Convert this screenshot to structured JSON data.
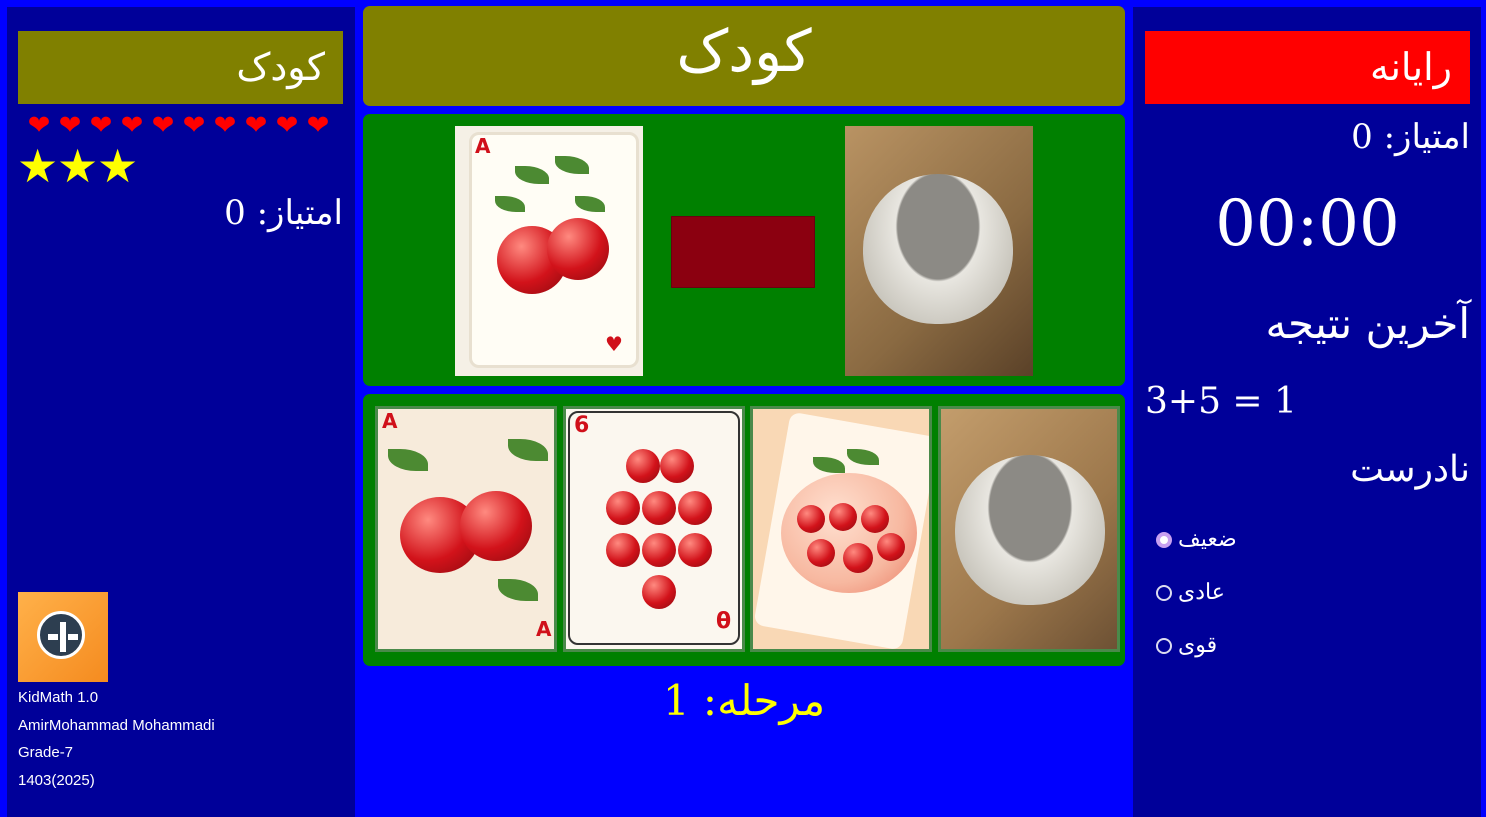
{
  "left_panel": {
    "player_name": "کودک",
    "hearts": [
      "❤",
      "❤",
      "❤",
      "❤",
      "❤",
      "❤",
      "❤",
      "❤",
      "❤",
      "❤"
    ],
    "stars": [
      "★",
      "★",
      "★"
    ],
    "score_text": "امتیاز: 0",
    "app_info": {
      "version": "KidMath 1.0",
      "author": "AmirMohammad Mohammadi",
      "grade": "Grade-7",
      "year": "1403(2025)"
    }
  },
  "center": {
    "title": "کودک",
    "question": {
      "left_card": "apple-card-image",
      "operator": "",
      "right_card": "empty-bowl-image"
    },
    "choices": [
      {
        "image": "two-apples-card"
      },
      {
        "image": "nine-apples-card"
      },
      {
        "image": "apple-card-with-crossed-apple"
      },
      {
        "image": "empty-bowl-image"
      }
    ],
    "level_text": "مرحله: 1"
  },
  "right_panel": {
    "player_name": "رایانه",
    "score_text": "امتیاز: 0",
    "timer": "00:00",
    "last_result_title": "آخرین نتیجه",
    "last_equation": "3+5 = 1",
    "last_result": "نادرست",
    "difficulty_options": [
      {
        "label": "ضعیف",
        "checked": true
      },
      {
        "label": "عادی",
        "checked": false
      },
      {
        "label": "قوی",
        "checked": false
      }
    ]
  },
  "colors": {
    "background": "#0000ff",
    "side_panel": "#000099",
    "player_bar": "#808000",
    "computer_bar": "#ff0000",
    "card_area": "#008000",
    "operator_box": "#8b0010",
    "level_text": "#ffff00"
  }
}
